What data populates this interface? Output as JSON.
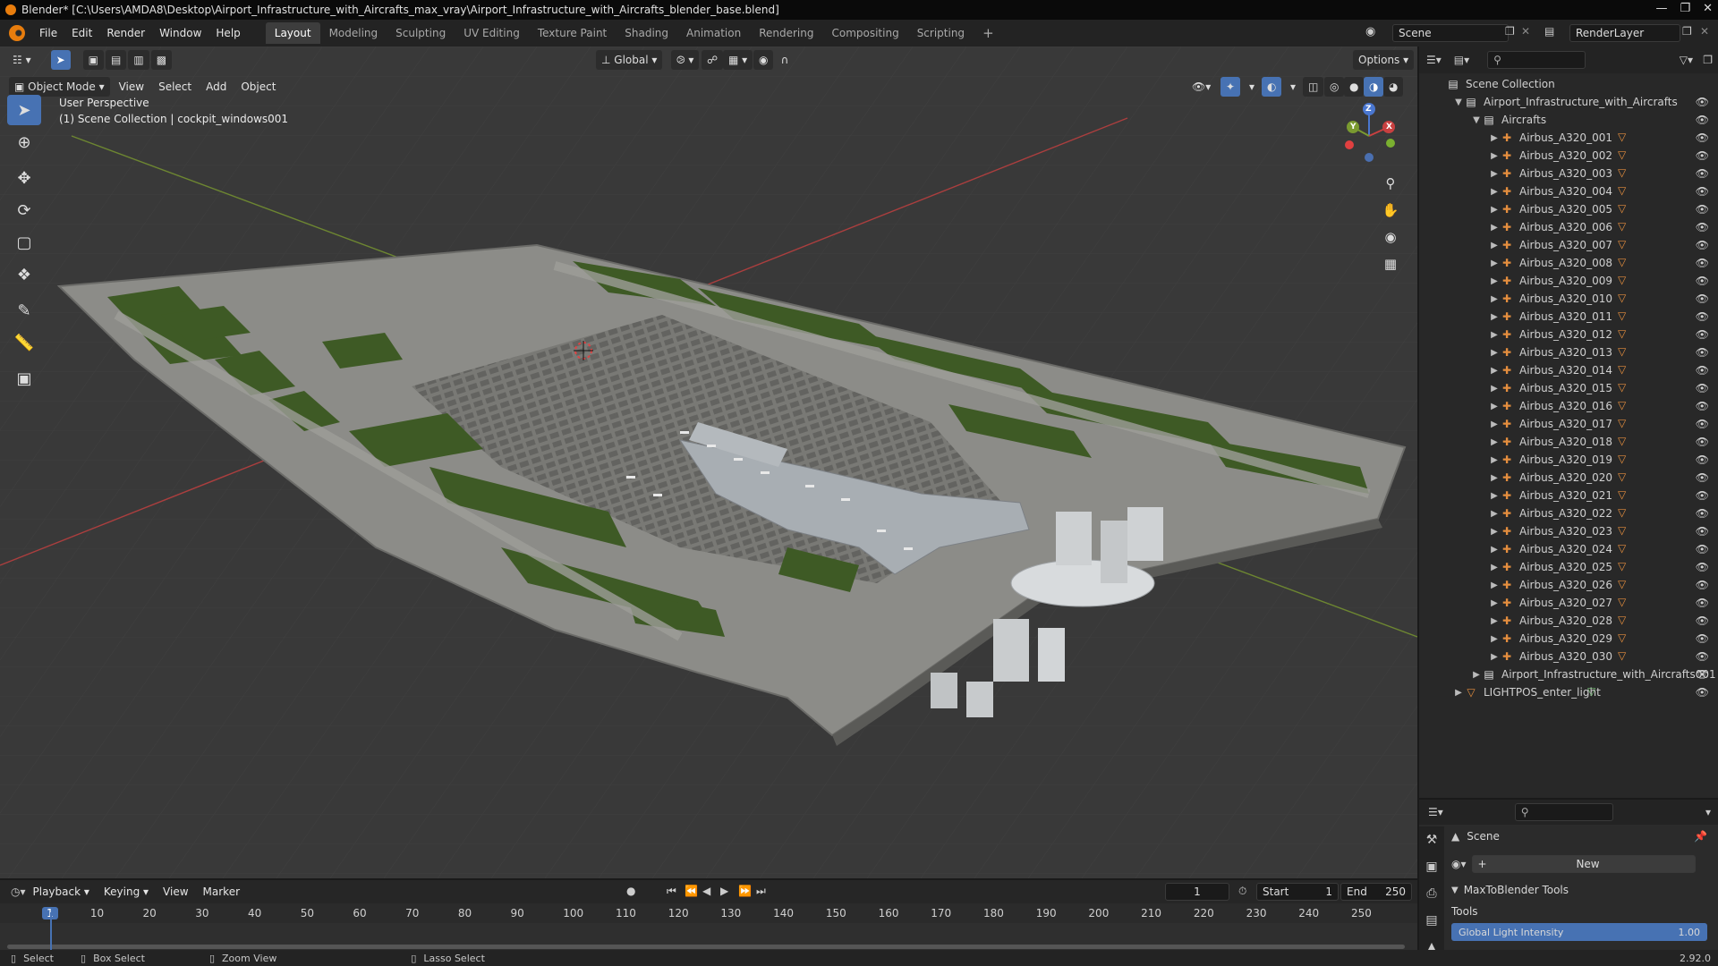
{
  "window": {
    "title": "Blender* [C:\\Users\\AMDA8\\Desktop\\Airport_Infrastructure_with_Aircrafts_max_vray\\Airport_Infrastructure_with_Aircrafts_blender_base.blend]"
  },
  "menu": [
    "File",
    "Edit",
    "Render",
    "Window",
    "Help"
  ],
  "workspaces": [
    "Layout",
    "Modeling",
    "Sculpting",
    "UV Editing",
    "Texture Paint",
    "Shading",
    "Animation",
    "Rendering",
    "Compositing",
    "Scripting"
  ],
  "scene_field": "Scene",
  "renderlayer_field": "RenderLayer",
  "viewport": {
    "transform_orientation": "Global",
    "options_label": "Options",
    "mode": "Object Mode",
    "header_menu": [
      "View",
      "Select",
      "Add",
      "Object"
    ],
    "perspective_label": "User Perspective",
    "context_label": "(1) Scene Collection | cockpit_windows001"
  },
  "gizmo": {
    "x": "X",
    "y": "Y",
    "z": "Z"
  },
  "outliner": {
    "root": "Scene Collection",
    "collection": "Airport_Infrastructure_with_Aircrafts",
    "sub_collection": "Aircrafts",
    "aircraft": [
      "Airbus_A320_001",
      "Airbus_A320_002",
      "Airbus_A320_003",
      "Airbus_A320_004",
      "Airbus_A320_005",
      "Airbus_A320_006",
      "Airbus_A320_007",
      "Airbus_A320_008",
      "Airbus_A320_009",
      "Airbus_A320_010",
      "Airbus_A320_011",
      "Airbus_A320_012",
      "Airbus_A320_013",
      "Airbus_A320_014",
      "Airbus_A320_015",
      "Airbus_A320_016",
      "Airbus_A320_017",
      "Airbus_A320_018",
      "Airbus_A320_019",
      "Airbus_A320_020",
      "Airbus_A320_021",
      "Airbus_A320_022",
      "Airbus_A320_023",
      "Airbus_A320_024",
      "Airbus_A320_025",
      "Airbus_A320_026",
      "Airbus_A320_027",
      "Airbus_A320_028",
      "Airbus_A320_029",
      "Airbus_A320_030"
    ],
    "extra_collection": "Airport_Infrastructure_with_Aircrafts001",
    "light_item": "LIGHTPOS_enter_light"
  },
  "properties": {
    "scene_label": "Scene",
    "new_button": "New",
    "panel_title": "MaxToBlender Tools",
    "tools_label": "Tools",
    "slider_label": "Global Light Intensity",
    "slider_value": "1.00"
  },
  "timeline": {
    "menus": [
      "Playback",
      "Keying",
      "View",
      "Marker"
    ],
    "current_frame": "1",
    "start_label": "Start",
    "start_value": "1",
    "end_label": "End",
    "end_value": "250",
    "ticks": [
      "1",
      "10",
      "20",
      "30",
      "40",
      "50",
      "60",
      "70",
      "80",
      "90",
      "100",
      "110",
      "120",
      "130",
      "140",
      "150",
      "160",
      "170",
      "180",
      "190",
      "200",
      "210",
      "220",
      "230",
      "240",
      "250"
    ]
  },
  "status": {
    "select": "Select",
    "box_select": "Box Select",
    "zoom_view": "Zoom View",
    "lasso_select": "Lasso Select",
    "version": "2.92.0"
  },
  "colors": {
    "accent": "#4772b3",
    "grass": "#3e5a25",
    "pavement": "#8a8a86",
    "axis_x": "#c84040",
    "axis_y": "#7a9a30",
    "object_icon": "#e58e3e"
  }
}
